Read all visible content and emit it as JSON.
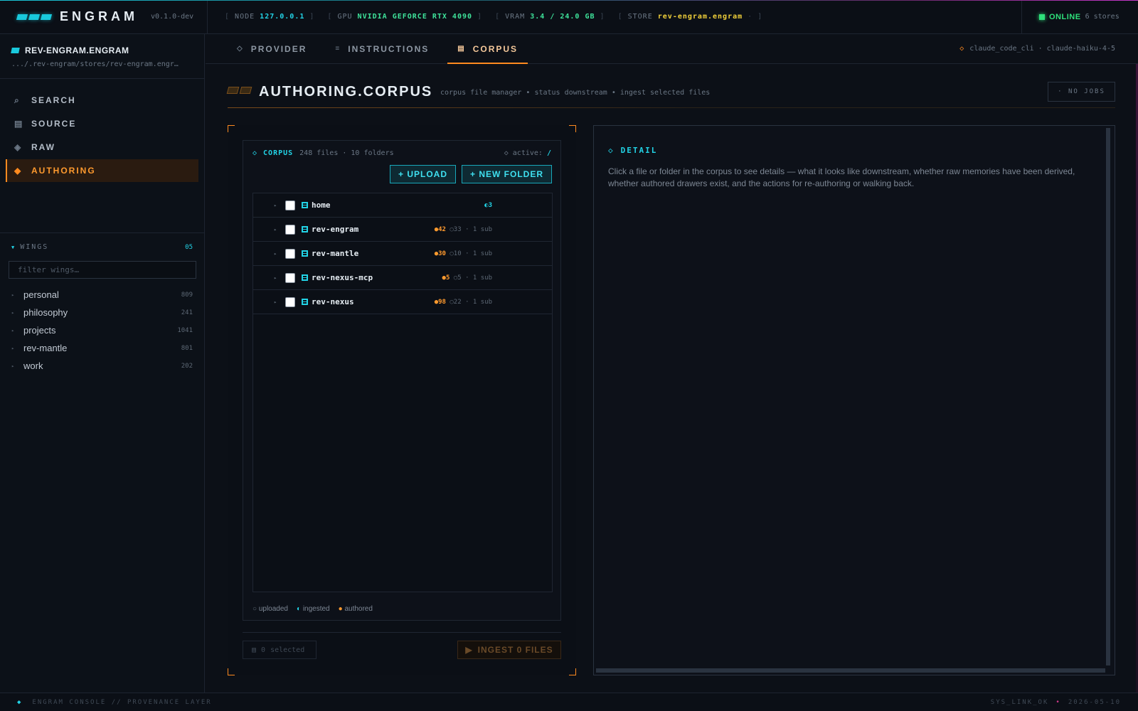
{
  "topbar": {
    "brand": "ENGRAM",
    "version": "v0.1.0-dev",
    "stats": [
      {
        "label": "NODE",
        "value": "127.0.0.1"
      },
      {
        "label": "GPU",
        "value": "NVIDIA GEFORCE RTX 4090"
      },
      {
        "label": "VRAM",
        "value": "3.4 / 24.0 GB"
      },
      {
        "label": "STORE",
        "value": "rev-engram.engram",
        "suffix": "·"
      }
    ],
    "status": "ONLINE",
    "store_count": "6 stores"
  },
  "sidebar": {
    "store_name": "REV-ENGRAM.ENGRAM",
    "store_path": ".../.rev-engram/stores/rev-engram.engr…",
    "nav": [
      {
        "label": "SEARCH",
        "icon": "⌕"
      },
      {
        "label": "SOURCE",
        "icon": "▤"
      },
      {
        "label": "RAW",
        "icon": "◈"
      },
      {
        "label": "AUTHORING",
        "icon": "◆"
      }
    ],
    "wings_label": "WINGS",
    "wings_count": "05",
    "filter_placeholder": "filter wings…",
    "wings": [
      {
        "name": "personal",
        "count": "809"
      },
      {
        "name": "philosophy",
        "count": "241"
      },
      {
        "name": "projects",
        "count": "1041"
      },
      {
        "name": "rev-mantle",
        "count": "801"
      },
      {
        "name": "work",
        "count": "202"
      }
    ]
  },
  "tabs": [
    {
      "label": "PROVIDER",
      "icon": "◇"
    },
    {
      "label": "INSTRUCTIONS",
      "icon": "≡"
    },
    {
      "label": "CORPUS",
      "icon": "▤"
    }
  ],
  "provider": "claude_code_cli · claude-haiku-4-5",
  "page": {
    "title": "AUTHORING.CORPUS",
    "subtitle": "corpus file manager • status downstream • ingest selected files",
    "jobs": "· NO JOBS"
  },
  "corpus": {
    "title": "CORPUS",
    "summary": "248 files · 10 folders",
    "active_label": "◇ active:",
    "active_path": "/",
    "upload_label": "+ UPLOAD",
    "new_folder_label": "+ NEW FOLDER",
    "folders": [
      {
        "name": "home",
        "ingested": "◐3",
        "authored": "",
        "uploaded": "",
        "sub": ""
      },
      {
        "name": "rev-engram",
        "ingested": "",
        "authored": "●42",
        "uploaded": "○33",
        "sub": "· 1 sub"
      },
      {
        "name": "rev-mantle",
        "ingested": "",
        "authored": "●30",
        "uploaded": "○10",
        "sub": "· 1 sub"
      },
      {
        "name": "rev-nexus-mcp",
        "ingested": "",
        "authored": "●5",
        "uploaded": "○5",
        "sub": "· 1 sub"
      },
      {
        "name": "rev-nexus",
        "ingested": "",
        "authored": "●98",
        "uploaded": "○22",
        "sub": "· 1 sub"
      }
    ],
    "legend": {
      "uploaded": "uploaded",
      "ingested": "ingested",
      "authored": "authored"
    },
    "selected_count": "0",
    "selected_label": "selected",
    "ingest_label": "INGEST 0 FILES"
  },
  "detail": {
    "title": "DETAIL",
    "body": "Click a file or folder in the corpus to see details — what it looks like downstream, whether raw memories have been derived, whether authored drawers exist, and the actions for re-authoring or walking back."
  },
  "footer": {
    "left": "ENGRAM CONSOLE // PROVENANCE LAYER",
    "sys": "SYS_LINK_OK",
    "date": "2026-05-10"
  },
  "colors": {
    "accent_cyan": "#22d3e6",
    "accent_orange": "#ff8a1f",
    "online_green": "#2ee07a",
    "vram_green": "#3ee29a",
    "store_yellow": "#f2d13a",
    "background": "#0c1017"
  }
}
